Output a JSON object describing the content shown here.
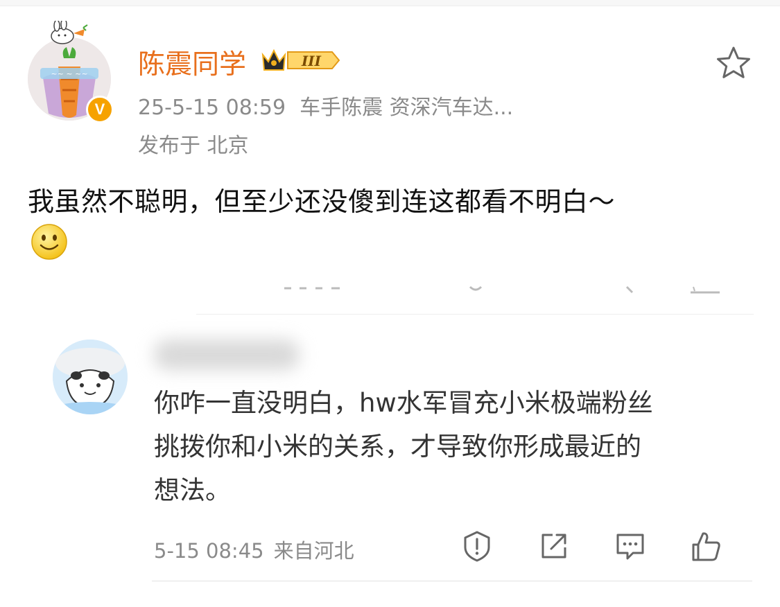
{
  "post": {
    "author": "陈震同学",
    "level_badge": "III",
    "timestamp": "25-5-15 08:59",
    "source": "车手陈震 资深汽车达...",
    "location": "发布于 北京",
    "text": "我虽然不聪明，但至少还没傻到连这都看不明白～",
    "verified_badge": "V"
  },
  "comment": {
    "text_lines": [
      "你咋一直没明白，hw水军冒充小米极端粉丝",
      "挑拨你和小米的关系，才导致你形成最近的",
      "想法。"
    ],
    "timestamp": "5-15 08:45",
    "source": "来自河北"
  },
  "colors": {
    "username": "#e86f1c",
    "meta_gray": "#8a8a8a",
    "verified": "#f6a200"
  },
  "icons": {
    "favorite": "star-outline-icon",
    "report": "warning-shield-icon",
    "share": "share-arrow-icon",
    "reply": "comment-bubble-icon",
    "like": "thumbs-up-icon"
  }
}
